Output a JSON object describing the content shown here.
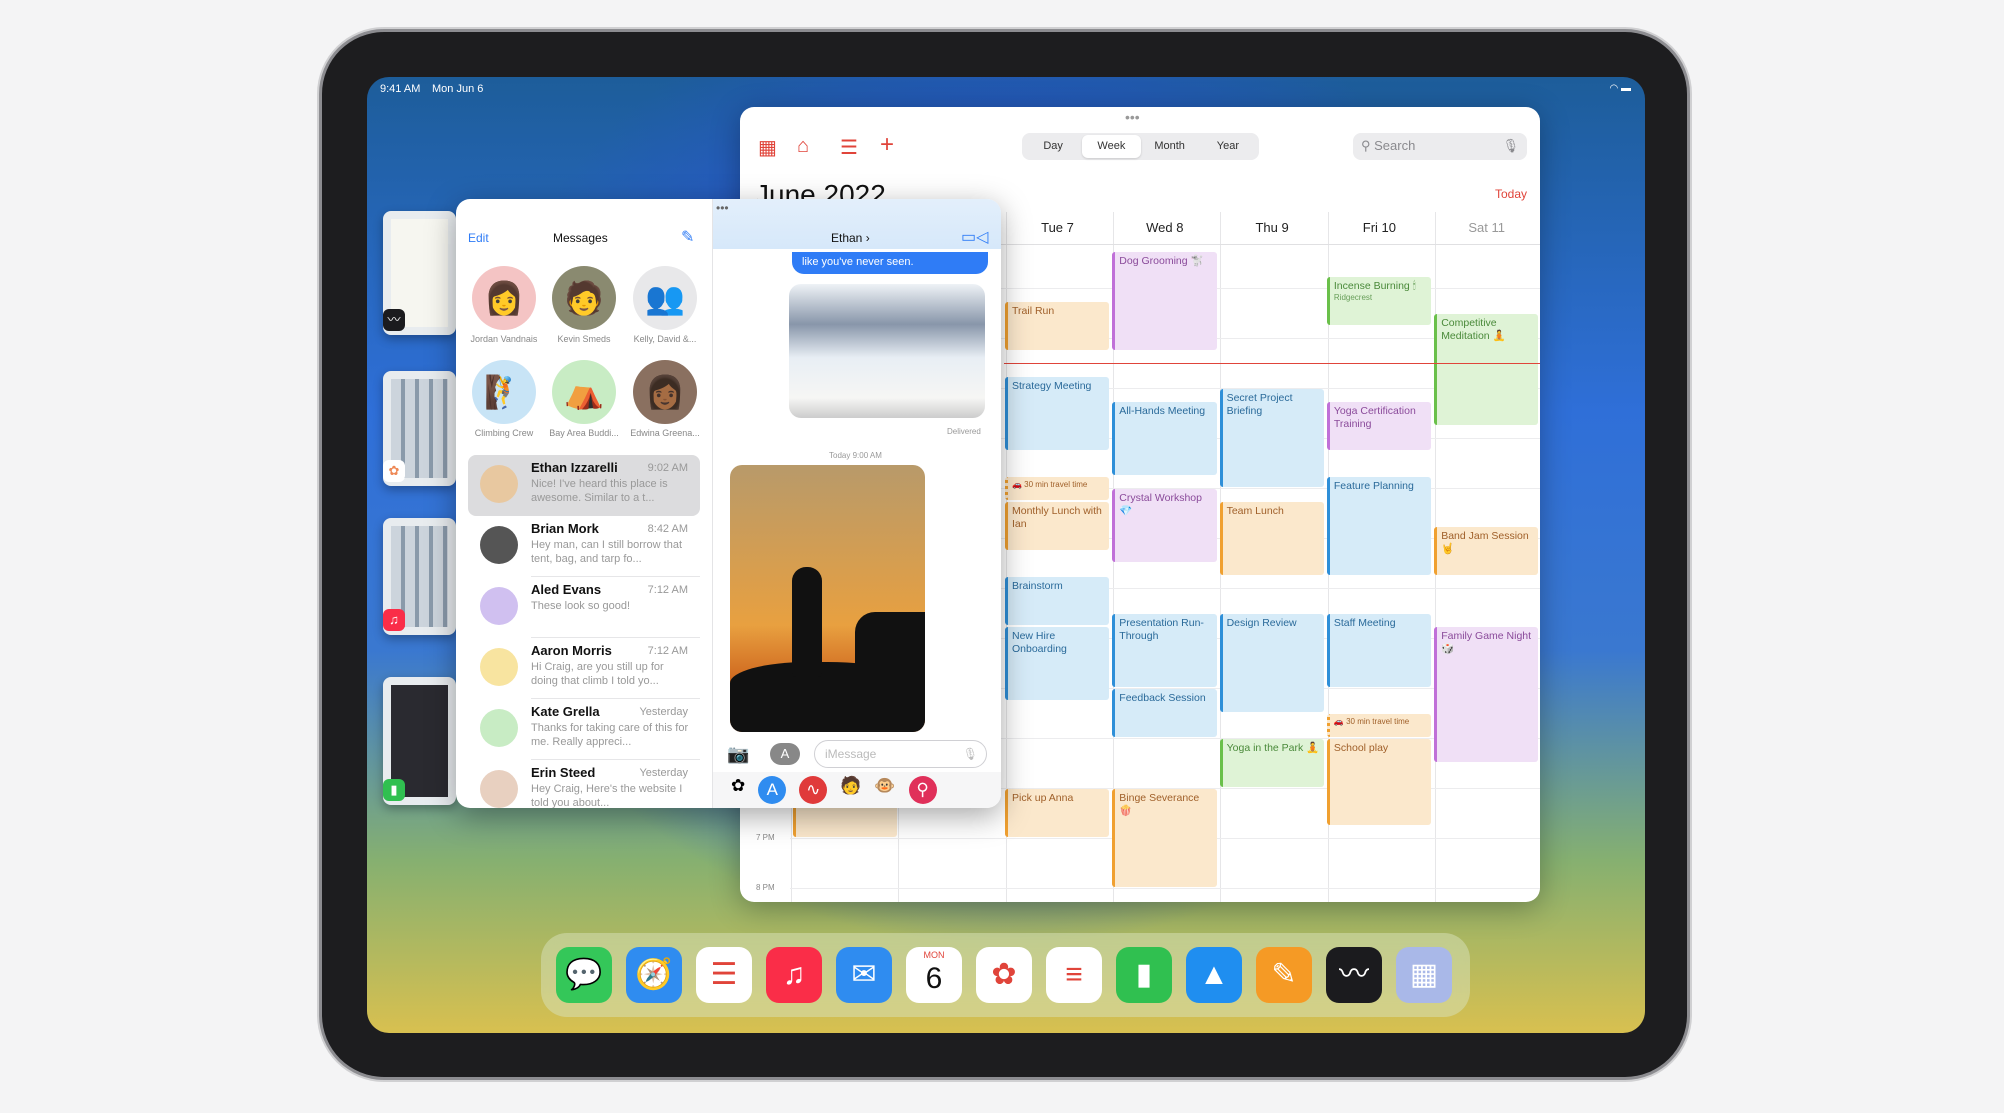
{
  "status_bar": {
    "time": "9:41 AM",
    "date": "Mon Jun 6"
  },
  "calendar": {
    "views": [
      "Day",
      "Week",
      "Month",
      "Year"
    ],
    "selected_view": "Week",
    "search_placeholder": "Search",
    "month_title": "June 2022",
    "today_label": "Today",
    "days": [
      "Tue 7",
      "Wed 8",
      "Thu 9",
      "Fri 10",
      "Sat 11"
    ],
    "time_labels": [
      "7 PM",
      "8 PM"
    ],
    "colors": {
      "orange": "#f0a030",
      "purple": "#c070d8",
      "blue": "#2e8fd8",
      "green": "#6ac04a",
      "now_line": "#e0443a"
    },
    "now_hour": 9.5,
    "events": [
      {
        "title": "",
        "day": "Sun",
        "start": 18,
        "end": 19,
        "color": "orange"
      },
      {
        "title": "Dog Grooming 🐩",
        "day": "Wed 8",
        "start": 7.25,
        "end": 9.25,
        "color": "purple"
      },
      {
        "title": "Trail Run",
        "day": "Tue 7",
        "start": 8.25,
        "end": 9.25,
        "color": "orange"
      },
      {
        "title": "Incense Burning 🕯",
        "subtitle": "Ridgecrest",
        "day": "Fri 10",
        "start": 7.75,
        "end": 8.75,
        "color": "green"
      },
      {
        "title": "Competitive Meditation 🧘",
        "day": "Sat 11",
        "start": 8.5,
        "end": 10.75,
        "color": "green"
      },
      {
        "title": "Strategy Meeting",
        "day": "Tue 7",
        "start": 9.75,
        "end": 11.25,
        "color": "blue"
      },
      {
        "title": "All-Hands Meeting",
        "day": "Wed 8",
        "start": 10.25,
        "end": 11.75,
        "color": "blue"
      },
      {
        "title": "Secret Project Briefing",
        "day": "Thu 9",
        "start": 10,
        "end": 12,
        "color": "blue"
      },
      {
        "title": "Yoga Certification Training",
        "day": "Fri 10",
        "start": 10.25,
        "end": 11.25,
        "color": "purple"
      },
      {
        "title": "Feature Planning",
        "day": "Fri 10",
        "start": 11.75,
        "end": 13.75,
        "color": "blue"
      },
      {
        "title": "🚗 30 min travel time",
        "day": "Tue 7",
        "start": 11.75,
        "end": 12.25,
        "color": "orange",
        "travel": true
      },
      {
        "title": "Monthly Lunch with Ian",
        "day": "Tue 7",
        "start": 12.25,
        "end": 13.25,
        "color": "orange"
      },
      {
        "title": "Crystal Workshop 💎",
        "day": "Wed 8",
        "start": 12,
        "end": 13.5,
        "color": "purple"
      },
      {
        "title": "Team Lunch",
        "day": "Thu 9",
        "start": 12.25,
        "end": 13.75,
        "color": "orange"
      },
      {
        "title": "Band Jam Session 🤘",
        "day": "Sat 11",
        "start": 12.75,
        "end": 13.75,
        "color": "orange"
      },
      {
        "title": "Brainstorm",
        "day": "Tue 7",
        "start": 13.75,
        "end": 14.75,
        "color": "blue"
      },
      {
        "title": "New Hire Onboarding",
        "day": "Tue 7",
        "start": 14.75,
        "end": 16.25,
        "color": "blue"
      },
      {
        "title": "Presentation Run-Through",
        "day": "Wed 8",
        "start": 14.5,
        "end": 16,
        "color": "blue"
      },
      {
        "title": "Feedback Session",
        "day": "Wed 8",
        "start": 16,
        "end": 17,
        "color": "blue"
      },
      {
        "title": "Design Review",
        "day": "Thu 9",
        "start": 14.5,
        "end": 16.5,
        "color": "blue"
      },
      {
        "title": "Staff Meeting",
        "day": "Fri 10",
        "start": 14.5,
        "end": 16,
        "color": "blue"
      },
      {
        "title": "Family Game Night 🎲",
        "day": "Sat 11",
        "start": 14.75,
        "end": 17.5,
        "color": "purple"
      },
      {
        "title": "🚗 30 min travel time",
        "day": "Fri 10",
        "start": 16.5,
        "end": 17,
        "color": "orange",
        "travel": true
      },
      {
        "title": "School play",
        "day": "Fri 10",
        "start": 17,
        "end": 18.75,
        "color": "orange"
      },
      {
        "title": "Yoga in the Park 🧘",
        "day": "Thu 9",
        "start": 17,
        "end": 18,
        "color": "green"
      },
      {
        "title": "Pick up Anna",
        "day": "Tue 7",
        "start": 18,
        "end": 19,
        "color": "orange"
      },
      {
        "title": "Binge Severance 🍿",
        "day": "Wed 8",
        "start": 18,
        "end": 20,
        "color": "orange"
      }
    ]
  },
  "messages": {
    "edit_label": "Edit",
    "title": "Messages",
    "pinned": [
      {
        "name": "Jordan Vandnais",
        "emoji": "👩",
        "bg": "#f4c4c4"
      },
      {
        "name": "Kevin Smeds",
        "emoji": "🧑",
        "bg": "#8a8a70"
      },
      {
        "name": "Kelly, David &...",
        "emoji": "👥",
        "bg": "#e8e8ea"
      },
      {
        "name": "Climbing Crew",
        "emoji": "🧗",
        "bg": "#c8e4f6"
      },
      {
        "name": "Bay Area Buddi...",
        "emoji": "⛺",
        "bg": "#c8ecc4"
      },
      {
        "name": "Edwina Greena...",
        "emoji": "👩🏾",
        "bg": "#8a7060"
      }
    ],
    "conversations": [
      {
        "name": "Ethan Izzarelli",
        "time": "9:02 AM",
        "preview": "Nice! I've heard this place is awesome. Similar to a t...",
        "selected": true
      },
      {
        "name": "Brian Mork",
        "time": "8:42 AM",
        "preview": "Hey man, can I still borrow that tent, bag, and tarp fo..."
      },
      {
        "name": "Aled Evans",
        "time": "7:12 AM",
        "preview": "These look so good!"
      },
      {
        "name": "Aaron Morris",
        "time": "7:12 AM",
        "preview": "Hi Craig, are you still up for doing that climb I told yo..."
      },
      {
        "name": "Kate Grella",
        "time": "Yesterday",
        "preview": "Thanks for taking care of this for me. Really appreci..."
      },
      {
        "name": "Erin Steed",
        "time": "Yesterday",
        "preview": "Hey Craig, Here's the website I told you about..."
      }
    ],
    "chat": {
      "contact": "Ethan",
      "bubble": "like you've never seen.",
      "delivered": "Delivered",
      "timestamp": "Today 9:00 AM",
      "input_placeholder": "iMessage"
    }
  },
  "dock": [
    {
      "app": "Messages",
      "icon": "messages-icon",
      "bg": "#34c759",
      "glyph": "💬"
    },
    {
      "app": "Safari",
      "icon": "safari-icon",
      "bg": "#2f8cf0",
      "glyph": "🧭"
    },
    {
      "app": "Reminders",
      "icon": "reminders-icon",
      "bg": "#ffffff",
      "glyph": "☰"
    },
    {
      "app": "Music",
      "icon": "music-icon",
      "bg": "#fa2d48",
      "glyph": "♫"
    },
    {
      "app": "Mail",
      "icon": "mail-icon",
      "bg": "#2f8cf0",
      "glyph": "✉"
    },
    {
      "app": "Calendar",
      "icon": "calendar-icon",
      "bg": "#ffffff",
      "glyph": "6",
      "day": "MON"
    },
    {
      "app": "Photos",
      "icon": "photos-icon",
      "bg": "#ffffff",
      "glyph": "✿"
    },
    {
      "app": "Notes",
      "icon": "notes-icon",
      "bg": "#ffffff",
      "glyph": "≡"
    },
    {
      "app": "Numbers",
      "icon": "numbers-icon",
      "bg": "#30c050",
      "glyph": "▮"
    },
    {
      "app": "Keynote",
      "icon": "keynote-icon",
      "bg": "#1f8ef0",
      "glyph": "▲"
    },
    {
      "app": "Pages",
      "icon": "pages-icon",
      "bg": "#f59a25",
      "glyph": "✎"
    },
    {
      "app": "Freeform",
      "icon": "freeform-icon",
      "bg": "#1b1b1e",
      "glyph": "〰"
    },
    {
      "app": "App Library",
      "icon": "app-library-icon",
      "bg": "#a9b8e8",
      "glyph": "▦"
    }
  ]
}
